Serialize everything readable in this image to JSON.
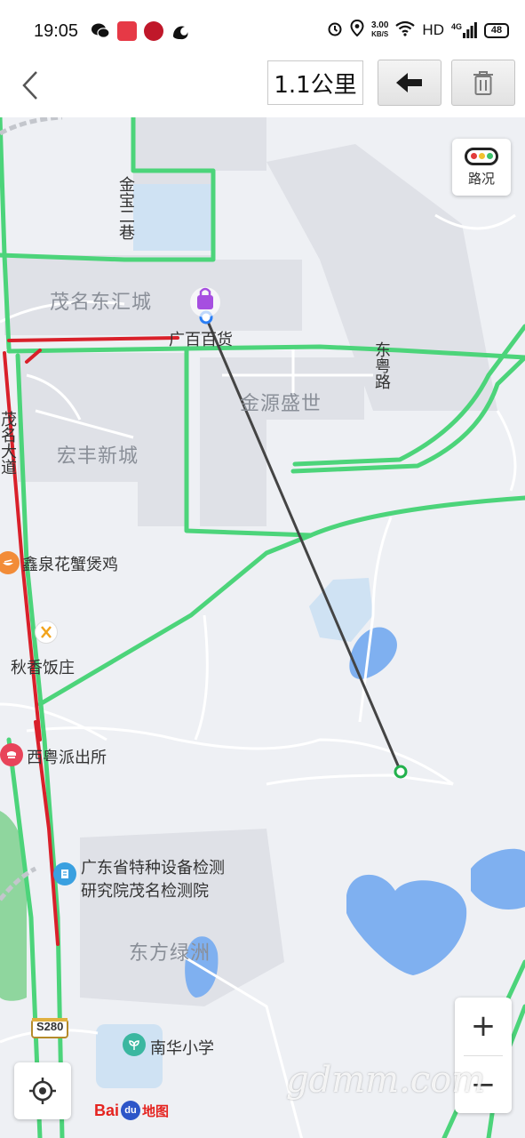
{
  "status_bar": {
    "time": "19:05",
    "net_speed_value": "3.00",
    "net_speed_unit": "KB/S",
    "hd": "HD",
    "network": "4G",
    "battery": "48"
  },
  "toolbar": {
    "distance": "1.1公里"
  },
  "map": {
    "labels": {
      "road_jinbao": "金宝二巷",
      "area_donghui": "茂名东汇城",
      "poi_guangbai": "广百百货",
      "road_dongyue": "东粤路",
      "area_jinyuan": "金源盛世",
      "area_hongfeng": "宏丰新城",
      "road_maoming": "茂名大道",
      "poi_xinquan": "鑫泉花蟹煲鸡",
      "poi_qiuxiang": "秋香饭庄",
      "poi_xiyue": "西粤派出所",
      "poi_inspect_line1": "广东省特种设备检测",
      "poi_inspect_line2": "研究院茂名检测院",
      "area_dongfang": "东方绿洲",
      "poi_nanhua": "南华小学",
      "road_shield": "S280"
    },
    "traffic_label": "路况",
    "zoom_in": "+",
    "zoom_out": "−",
    "baidu_text": "Bai",
    "baidu_du": "du",
    "baidu_map": "地图",
    "watermark": "gdmm.com",
    "colors": {
      "road_green": "#4cd47a",
      "road_red": "#d9202a",
      "water": "#7fb0f0",
      "building": "#dfe1e7",
      "measure_line": "#444444",
      "start_point": "#2a7ef5",
      "end_point": "#22b14c"
    }
  }
}
